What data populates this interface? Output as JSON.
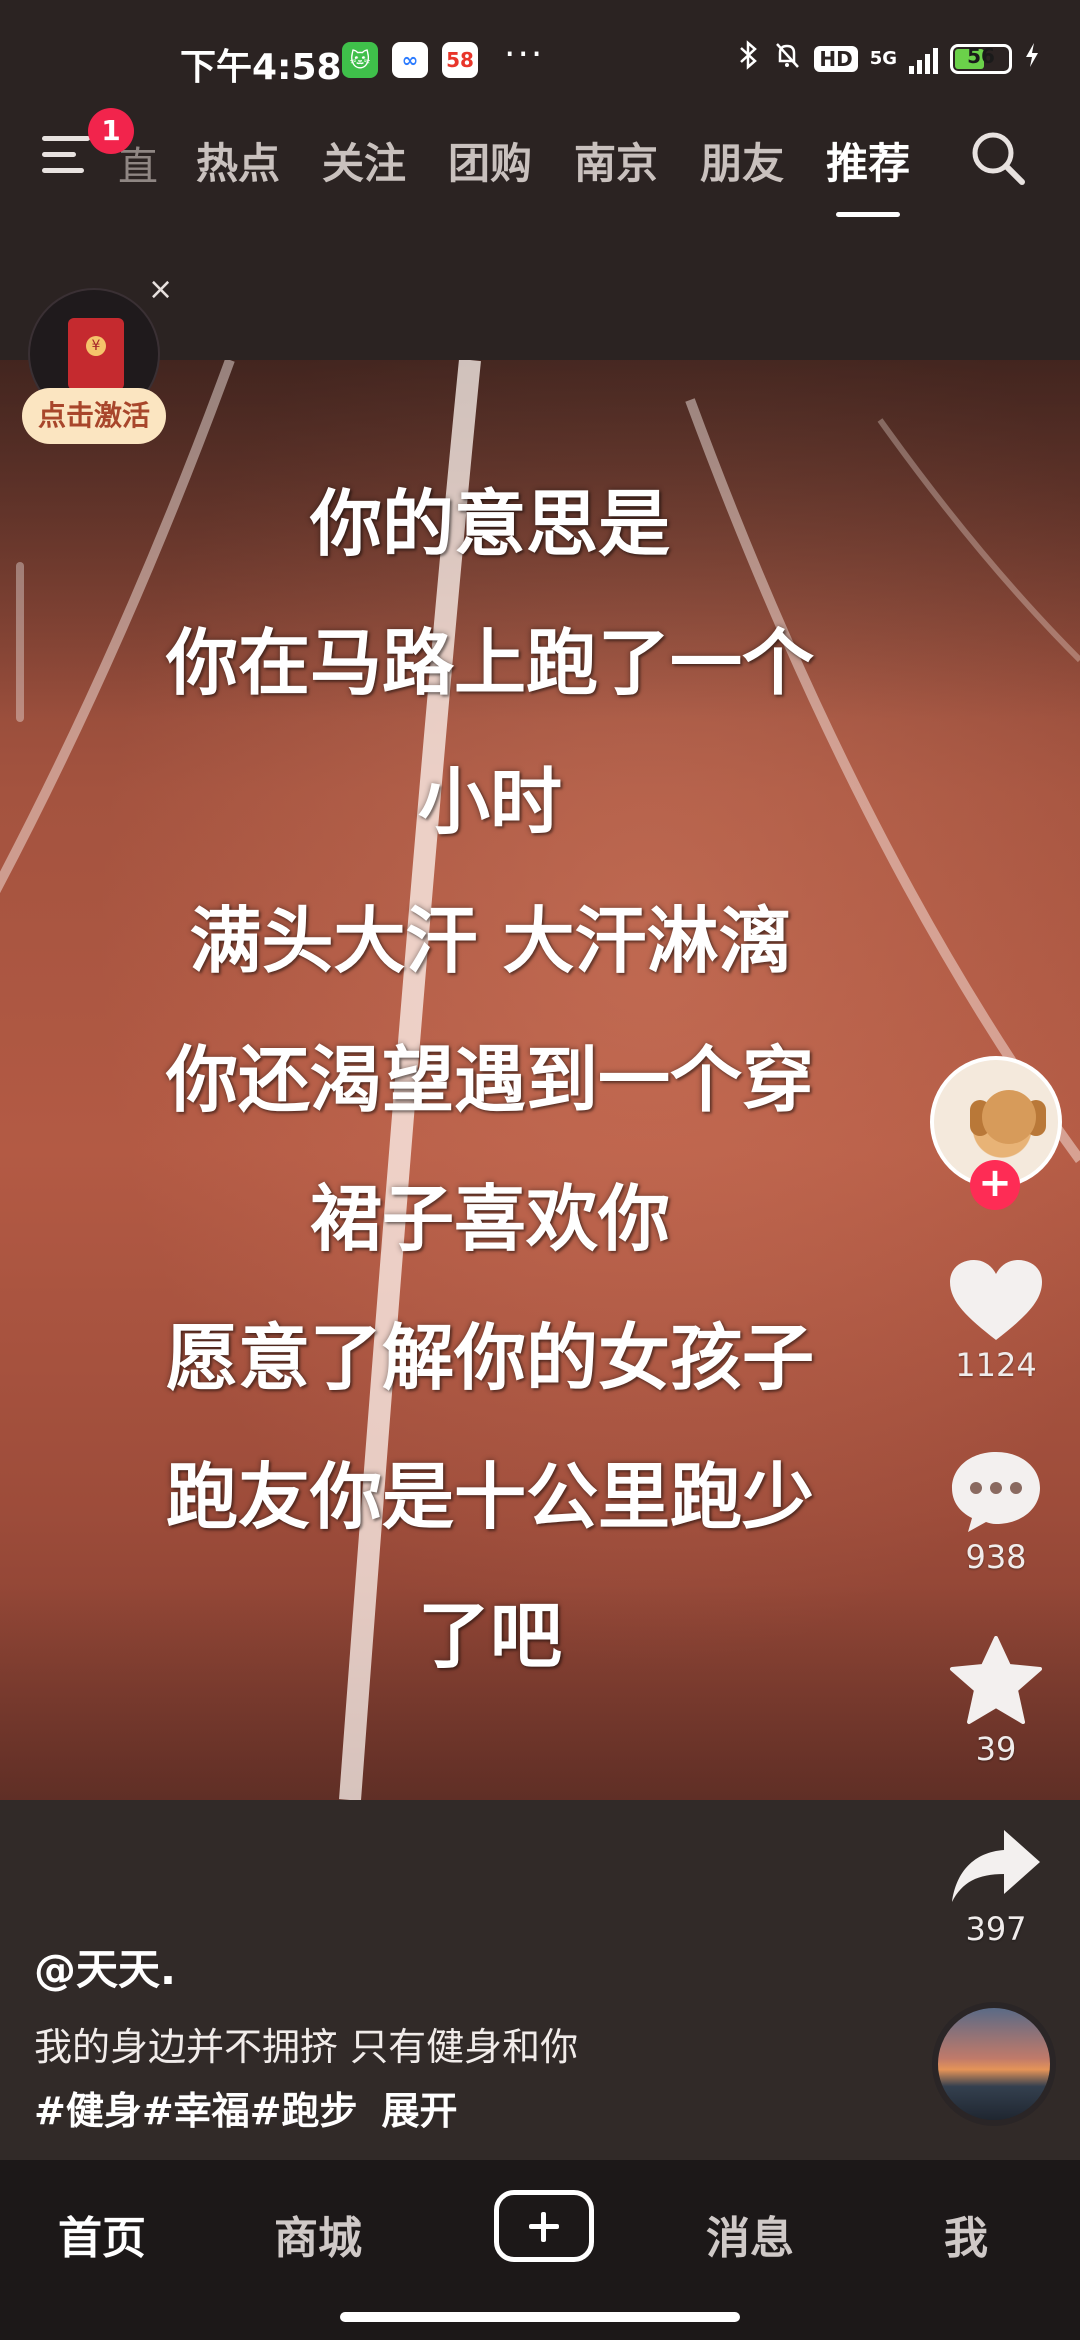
{
  "status_bar": {
    "time": "下午4:58",
    "app_badges": [
      "🐱",
      "∞",
      "58"
    ],
    "more": "···",
    "network": "5G",
    "hd": "HD",
    "battery": "56"
  },
  "top_nav": {
    "notification_count": "1",
    "partial_tab": "直播",
    "tabs": [
      {
        "label": "热点"
      },
      {
        "label": "关注"
      },
      {
        "label": "团购"
      },
      {
        "label": "南京"
      },
      {
        "label": "朋友"
      },
      {
        "label": "推荐"
      }
    ],
    "active_tab": "推荐"
  },
  "red_packet": {
    "label": "点击激活",
    "close": "×"
  },
  "video": {
    "caption_lines": [
      "你的意思是",
      "你在马路上跑了一个",
      "小时",
      "满头大汗 大汗淋漓",
      "你还渴望遇到一个穿",
      "裙子喜欢你",
      "愿意了解你的女孩子",
      "跑友你是十公里跑少",
      "了吧"
    ]
  },
  "actions": {
    "follow": "+",
    "likes": "1124",
    "comments": "938",
    "favorites": "39",
    "shares": "397"
  },
  "post": {
    "author": "@天天.",
    "description": "我的身边并不拥挤 只有健身和你",
    "tags": "#健身#幸福#跑步",
    "expand": "展开"
  },
  "tab_bar": {
    "home": "首页",
    "mall": "商城",
    "messages": "消息",
    "me": "我"
  }
}
